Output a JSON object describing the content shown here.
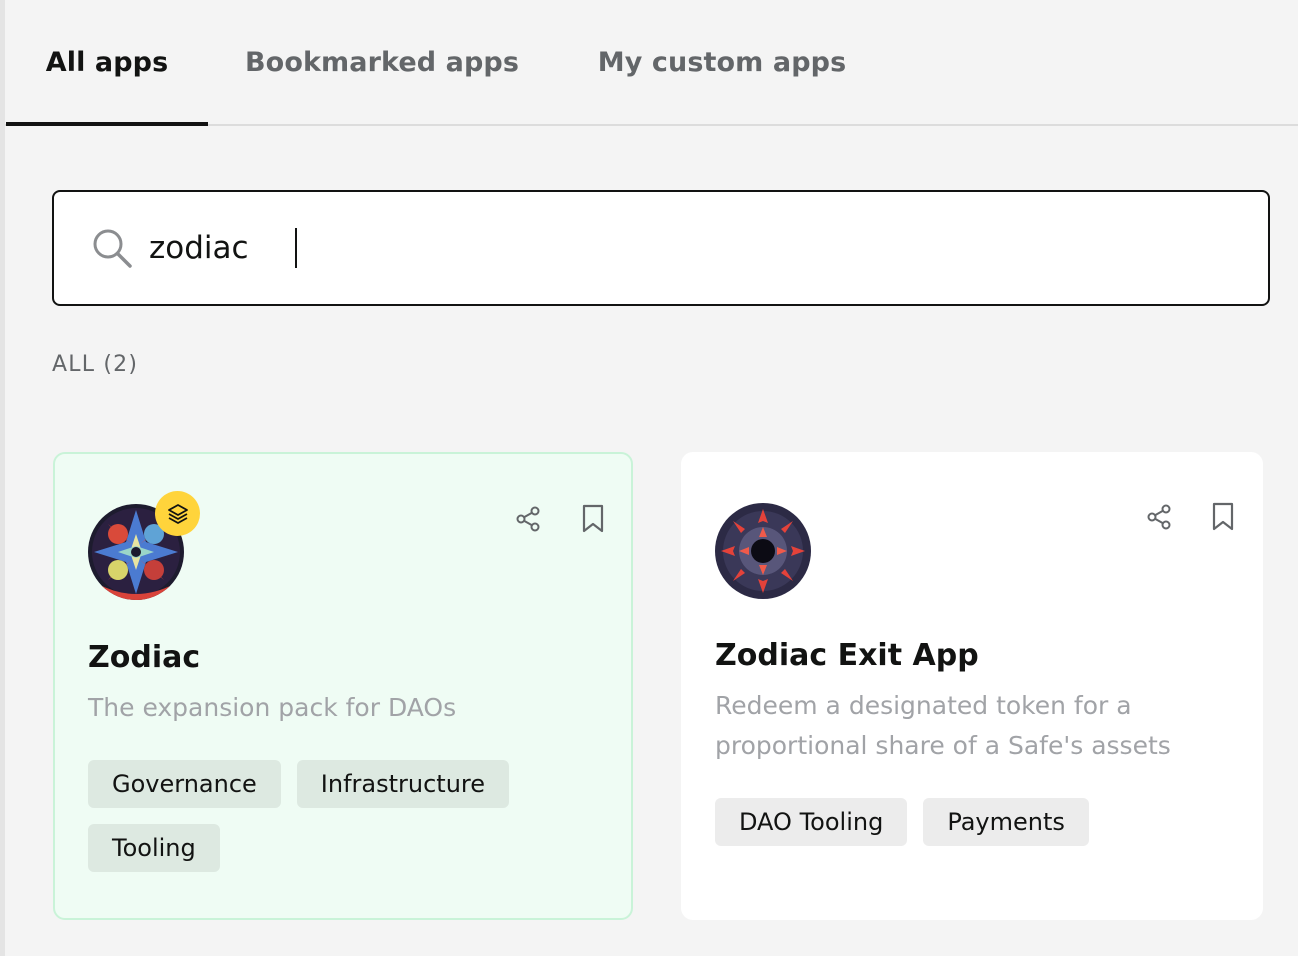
{
  "tabs": [
    {
      "label": "All apps",
      "active": true
    },
    {
      "label": "Bookmarked apps",
      "active": false
    },
    {
      "label": "My custom apps",
      "active": false
    }
  ],
  "search": {
    "value": "zodiac",
    "icon": "search-icon"
  },
  "results_count_label": "ALL (2)",
  "apps": [
    {
      "name": "Zodiac",
      "description": "The expansion pack for DAOs",
      "tags": [
        "Governance",
        "Infrastructure",
        "Tooling"
      ],
      "badge_icon": "layers-icon",
      "highlighted": true
    },
    {
      "name": "Zodiac Exit App",
      "description": "Redeem a designated token for a proportional share of a Safe's assets",
      "tags": [
        "DAO Tooling",
        "Payments"
      ],
      "highlighted": false
    }
  ],
  "colors": {
    "accent_text": "#121312",
    "muted_text": "#636669",
    "highlight_bg": "#effcf4",
    "highlight_border": "#c9f3d8",
    "badge": "#ffd43b"
  }
}
